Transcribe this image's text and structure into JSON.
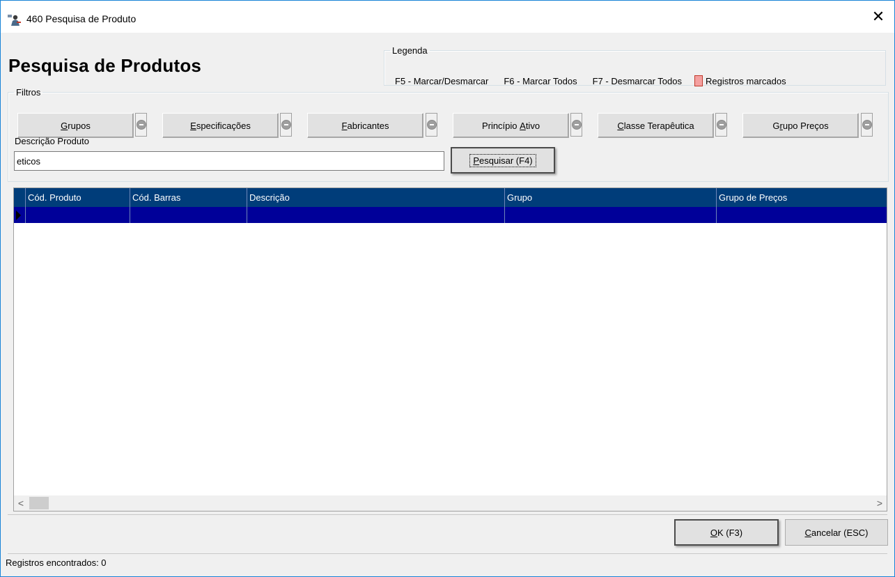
{
  "window": {
    "title": "460 Pesquisa de Produto",
    "icon": "user-search-icon",
    "close_glyph": "✕"
  },
  "page": {
    "heading": "Pesquisa de Produtos"
  },
  "legend": {
    "title": "Legenda",
    "items": [
      "F5 - Marcar/Desmarcar",
      "F6 - Marcar Todos",
      "F7 - Desmarcar Todos"
    ],
    "marked_label": "Registros marcados",
    "marked_color": "#f4a0a0"
  },
  "filters": {
    "title": "Filtros",
    "buttons": [
      {
        "accel": "G",
        "rest": "rupos"
      },
      {
        "accel": "E",
        "rest": "specificações"
      },
      {
        "accel": "F",
        "rest": "abricantes"
      },
      {
        "pre": "Princípio ",
        "accel": "A",
        "rest": "tivo"
      },
      {
        "accel": "C",
        "rest": "lasse Terapêutica"
      },
      {
        "pre": "G",
        "accel": "r",
        "rest": "upo Preços"
      }
    ],
    "clear_icon": "minus-circle-icon"
  },
  "search": {
    "label": "Descrição Produto",
    "value": "eticos",
    "button_accel": "P",
    "button_rest": "esquisar (F4)"
  },
  "grid": {
    "columns": [
      "Cód. Produto",
      "Cód. Barras",
      "Descrição",
      "Grupo",
      "Grupo de Preços"
    ],
    "header_color": "#003d7a",
    "selected_row_color": "#000099",
    "scroll_left": "<",
    "scroll_right": ">"
  },
  "actions": {
    "ok_accel": "O",
    "ok_rest": "K (F3)",
    "cancel_accel": "C",
    "cancel_rest": "ancelar (ESC)"
  },
  "status": {
    "text": "Registros encontrados: 0"
  }
}
